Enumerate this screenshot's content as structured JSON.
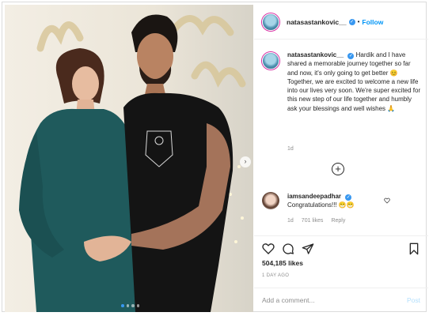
{
  "post": {
    "username": "natasastankovic__",
    "verified_glyph": "✓",
    "separator": "•",
    "follow_label": "Follow",
    "caption": "Hardik and I have shared a memorable journey together so far and now, it's only going to get better 😊 Together, we are excited to welcome a new life into our lives very soon. We're super excited for this new step of our life together and humbly ask your blessings and well wishes 🙏",
    "caption_time": "1d"
  },
  "comment": {
    "username": "iamsandeepadhar",
    "text": "Congratulations!!! 😁😁",
    "time": "1d",
    "likes": "701 likes",
    "reply_label": "Reply"
  },
  "actions": {
    "likes": "504,185 likes",
    "posted_ago": "1 DAY AGO",
    "add_comment_placeholder": "Add a comment...",
    "post_label": "Post",
    "load_more_glyph": "+"
  },
  "carousel": {
    "total": 4,
    "current": 1,
    "next_glyph": "›"
  },
  "icons": [
    "heart-icon",
    "comment-icon",
    "share-icon",
    "bookmark-icon",
    "chevron-right-icon"
  ],
  "colors": {
    "accent": "#0095f6",
    "text": "#262626",
    "muted": "#8e8e8e",
    "post_disabled": "#b2dffc"
  }
}
